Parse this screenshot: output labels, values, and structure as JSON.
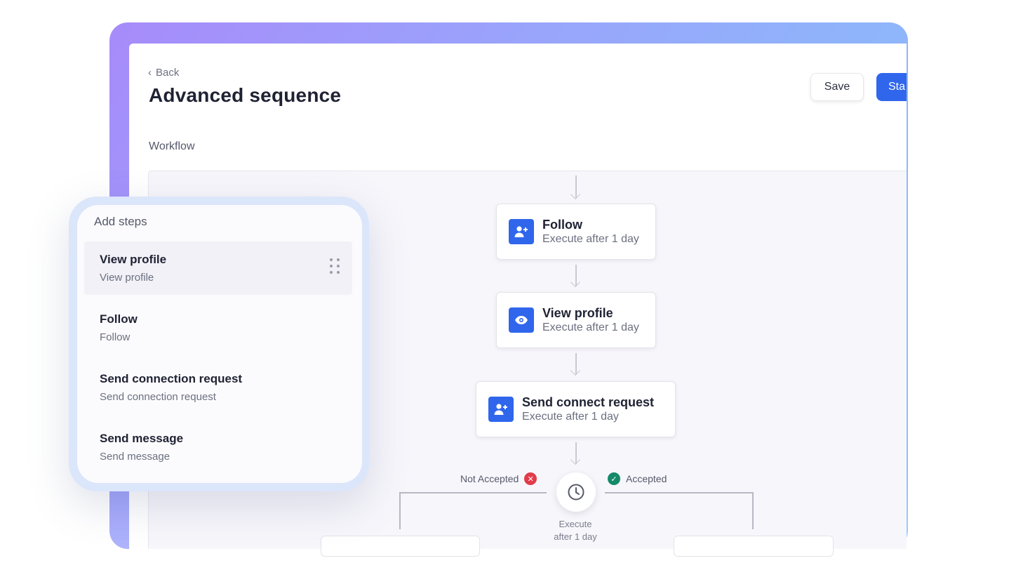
{
  "header": {
    "back_label": "Back",
    "title": "Advanced sequence",
    "save_label": "Save",
    "start_label": "Sta"
  },
  "workflow": {
    "section_label": "Workflow",
    "nodes": [
      {
        "title": "Follow",
        "subtitle": "Execute after 1 day",
        "icon": "user-plus-icon"
      },
      {
        "title": "View profile",
        "subtitle": "Execute after 1 day",
        "icon": "eye-icon"
      },
      {
        "title": "Send connect request",
        "subtitle": "Execute after 1 day",
        "icon": "user-plus-icon"
      }
    ],
    "branch": {
      "not_accepted_label": "Not Accepted",
      "accepted_label": "Accepted",
      "delay_line1": "Execute",
      "delay_line2": "after 1 day"
    }
  },
  "add_steps": {
    "title": "Add steps",
    "items": [
      {
        "title": "View profile",
        "subtitle": "View profile"
      },
      {
        "title": "Follow",
        "subtitle": "Follow"
      },
      {
        "title": "Send connection request",
        "subtitle": "Send connection request"
      },
      {
        "title": "Send message",
        "subtitle": "Send message"
      }
    ]
  },
  "colors": {
    "accent": "#2f66ec",
    "rejected": "#e23b4a",
    "accepted": "#138a6a"
  }
}
